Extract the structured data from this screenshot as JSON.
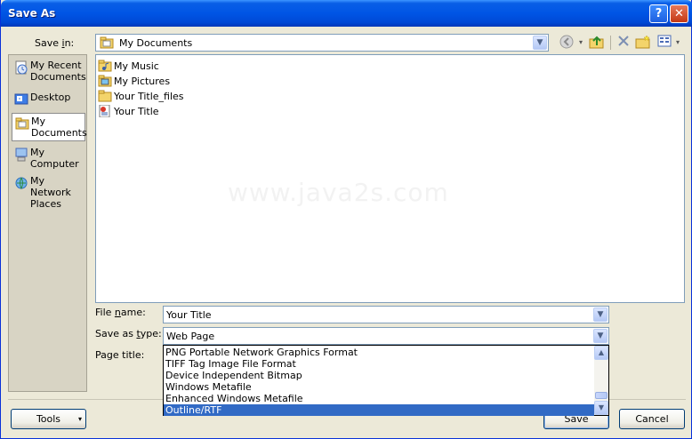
{
  "window": {
    "title": "Save As",
    "help_glyph": "?",
    "close_glyph": "✕"
  },
  "save_in": {
    "label_pre": "Save ",
    "label_key": "i",
    "label_post": "n:",
    "value": "My Documents"
  },
  "toolbar": {
    "back_icon": "back-icon",
    "up_icon": "up-folder-icon",
    "delete_icon": "delete-icon",
    "new_folder_icon": "new-folder-icon",
    "views_icon": "views-menu-icon"
  },
  "places": [
    {
      "label": "My Recent Documents",
      "icon": "recent-documents-icon"
    },
    {
      "label": "Desktop",
      "icon": "desktop-icon"
    },
    {
      "label": "My Documents",
      "icon": "my-documents-icon",
      "selected": true
    },
    {
      "label": "My Computer",
      "icon": "my-computer-icon"
    },
    {
      "label": "My Network Places",
      "icon": "network-places-icon"
    }
  ],
  "files": [
    {
      "name": "My Music",
      "icon": "music-folder-icon"
    },
    {
      "name": "My Pictures",
      "icon": "pictures-folder-icon"
    },
    {
      "name": "Your Title_files",
      "icon": "folder-icon"
    },
    {
      "name": "Your Title",
      "icon": "web-page-icon"
    }
  ],
  "watermark": "www.java2s.com",
  "file_name": {
    "label_pre": "File ",
    "label_key": "n",
    "label_post": "ame:",
    "value": "Your Title"
  },
  "save_as_type": {
    "label_pre": "Save as ",
    "label_key": "t",
    "label_post": "ype:",
    "value": "Web Page"
  },
  "page_title": {
    "label": "Page title:"
  },
  "type_options": [
    "PNG Portable Network Graphics Format",
    "TIFF Tag Image File Format",
    "Device Independent Bitmap",
    "Windows Metafile",
    "Enhanced Windows Metafile",
    "Outline/RTF"
  ],
  "selected_option": "Outline/RTF",
  "buttons": {
    "tools": "Tools",
    "tools_arrow": "▾",
    "save": "Save",
    "cancel": "Cancel"
  }
}
